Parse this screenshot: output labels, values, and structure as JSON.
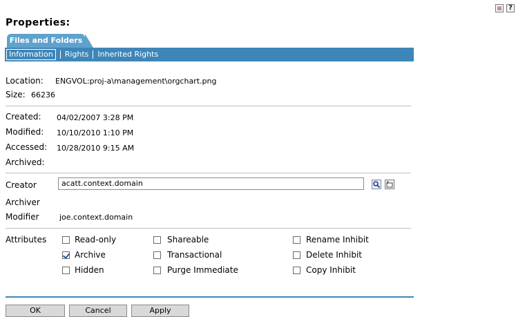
{
  "header": {
    "title": "Properties:",
    "icons": [
      "notes-icon",
      "help-icon"
    ]
  },
  "tabs": {
    "main": "Files and Folders",
    "sub": [
      "Information",
      "Rights",
      "Inherited Rights"
    ]
  },
  "info": {
    "location_label": "Location:",
    "location_value": "ENGVOL:proj-a\\management\\orgchart.png",
    "size_label": "Size:",
    "size_value": "66236",
    "created_label": "Created:",
    "created_value": "04/02/2007  3:28 PM",
    "modified_label": "Modified:",
    "modified_value": "10/10/2010  1:10 PM",
    "accessed_label": "Accessed:",
    "accessed_value": "10/28/2010  9:15 AM",
    "archived_label": "Archived:"
  },
  "owners": {
    "creator_label": "Creator",
    "creator_value": "acatt.context.domain",
    "archiver_label": "Archiver",
    "modifier_label": "Modifier",
    "modifier_value": "joe.context.domain"
  },
  "attributes": {
    "label": "Attributes",
    "items": [
      {
        "label": "Read-only",
        "checked": false
      },
      {
        "label": "Shareable",
        "checked": false
      },
      {
        "label": "Rename Inhibit",
        "checked": false
      },
      {
        "label": "Archive",
        "checked": true
      },
      {
        "label": "Transactional",
        "checked": false
      },
      {
        "label": "Delete Inhibit",
        "checked": false
      },
      {
        "label": "Hidden",
        "checked": false
      },
      {
        "label": "Purge Immediate",
        "checked": false
      },
      {
        "label": "Copy Inhibit",
        "checked": false
      }
    ]
  },
  "buttons": {
    "ok": "OK",
    "cancel": "Cancel",
    "apply": "Apply"
  }
}
